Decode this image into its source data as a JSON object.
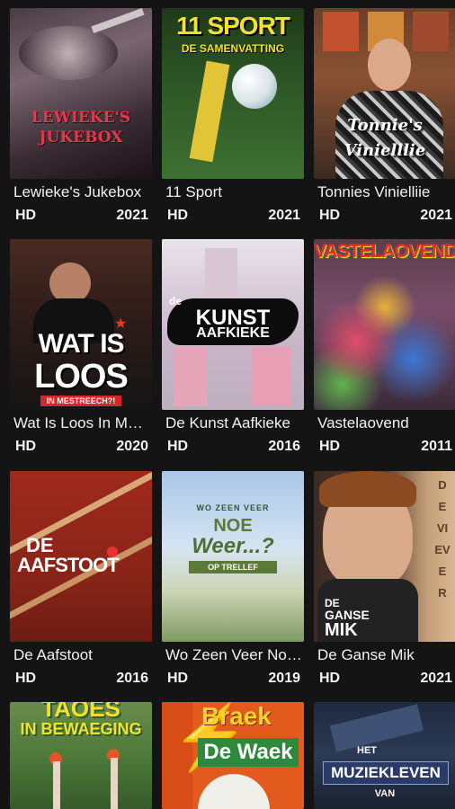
{
  "items": [
    {
      "title": "Lewieke's Jukebox",
      "quality": "HD",
      "year": "2021",
      "thumb_text": [
        "LEWIEKE'S",
        "JUKEBOX"
      ]
    },
    {
      "title": "11 Sport",
      "quality": "HD",
      "year": "2021",
      "thumb_text": [
        "11 SPORT",
        "DE SAMENVATTING"
      ]
    },
    {
      "title": "Tonnies Vinielliie",
      "quality": "HD",
      "year": "2021",
      "thumb_text": [
        "Tonnie's",
        "Vinielllie"
      ]
    },
    {
      "title": "Wat Is Loos In Mestreech",
      "quality": "HD",
      "year": "2020",
      "thumb_text": [
        "WAT IS",
        "LOOS",
        "IN MESTREECH?!"
      ]
    },
    {
      "title": "De Kunst Aafkieke",
      "quality": "HD",
      "year": "2016",
      "thumb_text": [
        "de",
        "KUNST",
        "AAFKIEKE"
      ]
    },
    {
      "title": "Vastelaovend",
      "quality": "HD",
      "year": "2011",
      "thumb_text": [
        "VASTELAOVEND!"
      ]
    },
    {
      "title": "De Aafstoot",
      "quality": "HD",
      "year": "2016",
      "thumb_text": [
        "DE",
        "AAFSTOOT"
      ]
    },
    {
      "title": "Wo Zeen Veer Noe Weer...?",
      "quality": "HD",
      "year": "2019",
      "thumb_text": [
        "WO ZEEN VEER",
        "NOE",
        "Weer...?",
        "OP TRELLEF"
      ]
    },
    {
      "title": "De Ganse Mik",
      "quality": "HD",
      "year": "2021",
      "thumb_text": [
        "DE",
        "GANSE",
        "MIK",
        "DE VIEVER"
      ]
    },
    {
      "title": "",
      "quality": "",
      "year": "",
      "thumb_text": [
        "TAOES",
        "IN BEWAEGING"
      ]
    },
    {
      "title": "",
      "quality": "",
      "year": "",
      "thumb_text": [
        "Braek",
        "De Waek"
      ]
    },
    {
      "title": "",
      "quality": "",
      "year": "",
      "thumb_text": [
        "HET",
        "MUZIEKLEVEN",
        "VAN"
      ]
    }
  ]
}
